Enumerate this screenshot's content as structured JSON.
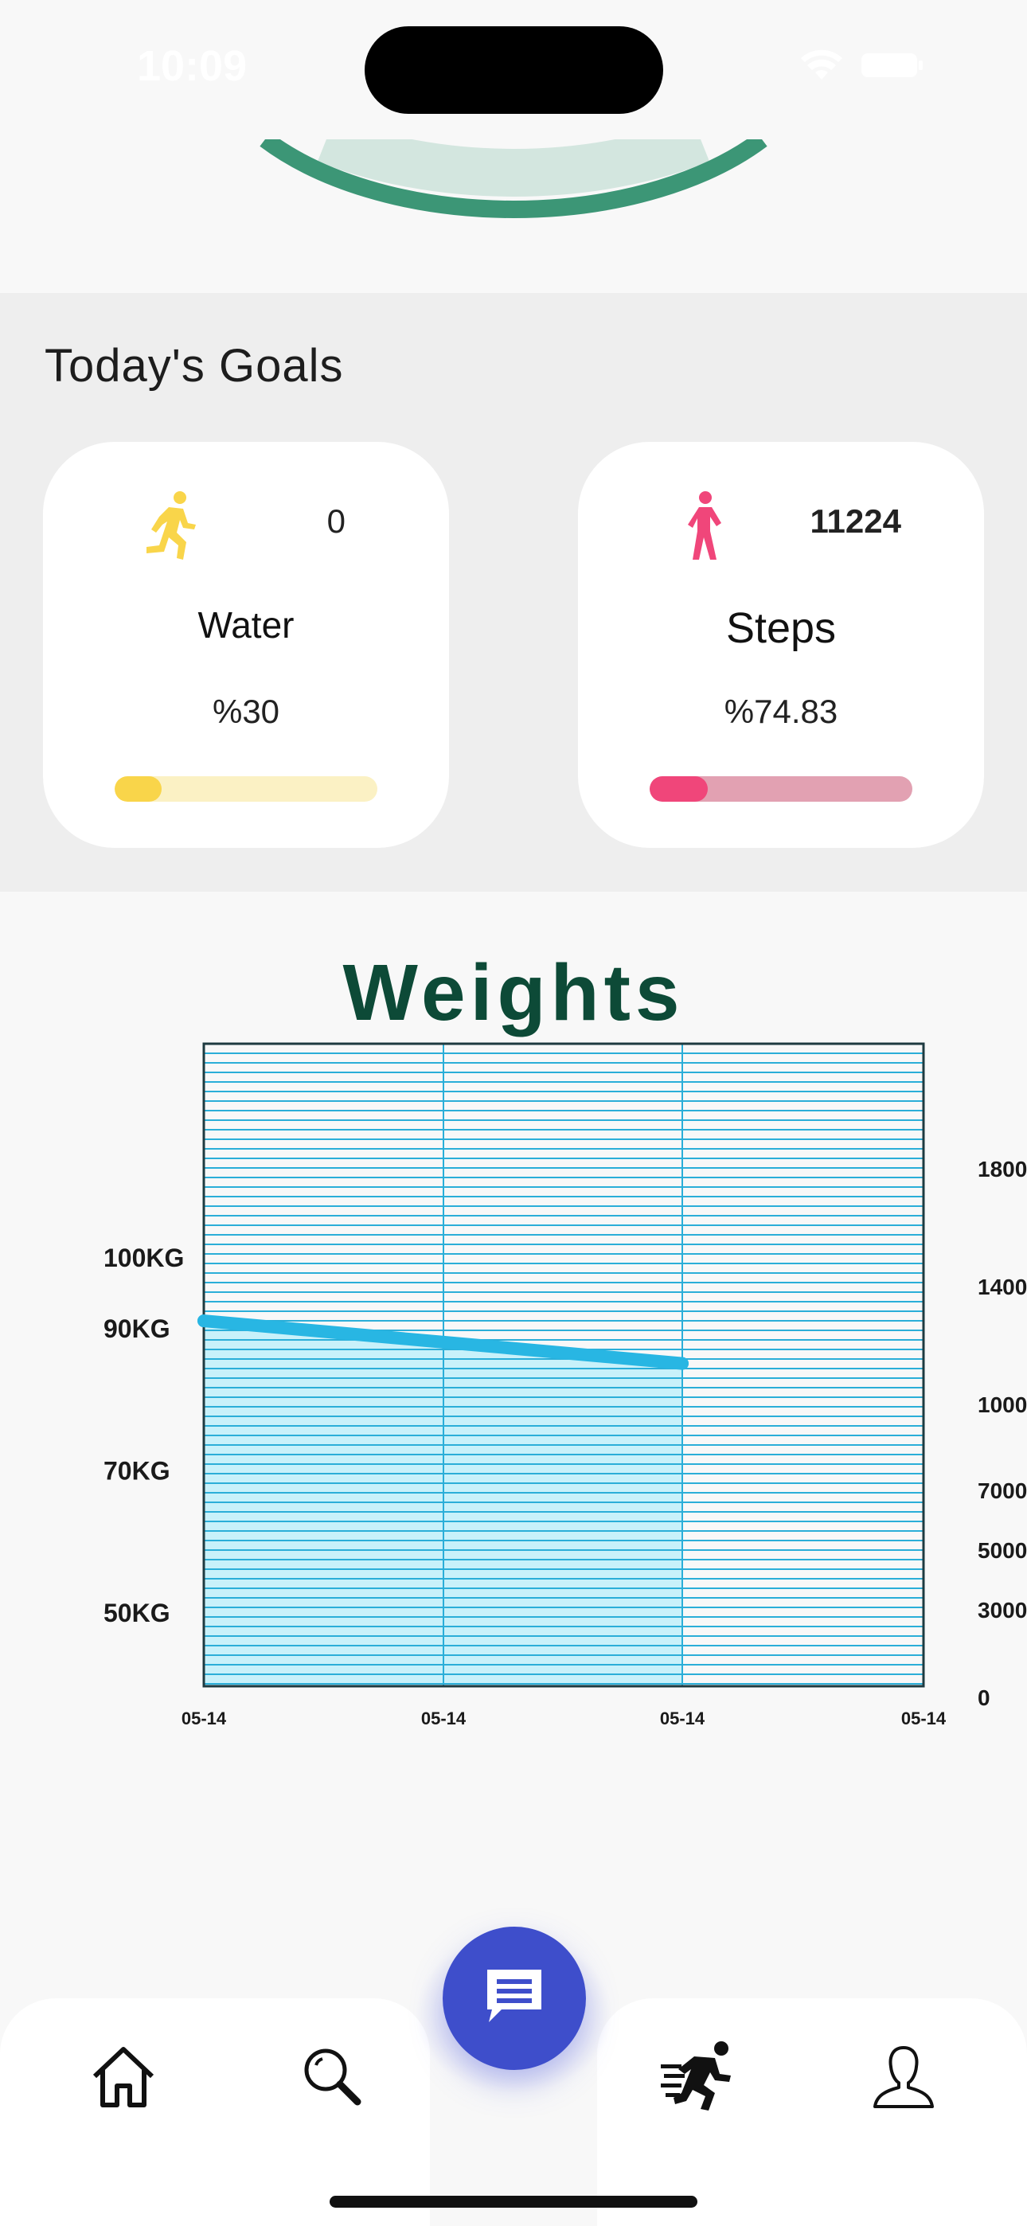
{
  "status_bar": {
    "time": "10:09"
  },
  "goals": {
    "title": "Today's Goals",
    "cards": [
      {
        "name": "Water",
        "value": "0",
        "percent_label": "%30",
        "progress": 0.18,
        "icon": "running-person-icon",
        "color": "#f9d54a",
        "track_color": "#fbf1c4"
      },
      {
        "name": "Steps",
        "value": "11224",
        "percent_label": "%74.83",
        "progress": 0.22,
        "icon": "walking-person-icon",
        "color": "#f0467a",
        "track_color": "#e2a1b2"
      }
    ]
  },
  "chart_data": {
    "type": "area",
    "title": "Weights",
    "x": [
      "05-14",
      "05-14",
      "05-14",
      "05-14"
    ],
    "series": [
      {
        "values": [
          91,
          88,
          85,
          null
        ]
      }
    ],
    "left_ticks": [
      "100KG",
      "90KG",
      "70KG",
      "50KG"
    ],
    "right_ticks": [
      "1800",
      "1400",
      "1000",
      "7000",
      "5000",
      "3000",
      "0"
    ],
    "grid": true
  },
  "nav": {
    "items": [
      {
        "icon": "home-icon"
      },
      {
        "icon": "search-icon"
      },
      {
        "icon": "chat-icon"
      },
      {
        "icon": "workout-icon"
      },
      {
        "icon": "profile-icon"
      }
    ]
  }
}
